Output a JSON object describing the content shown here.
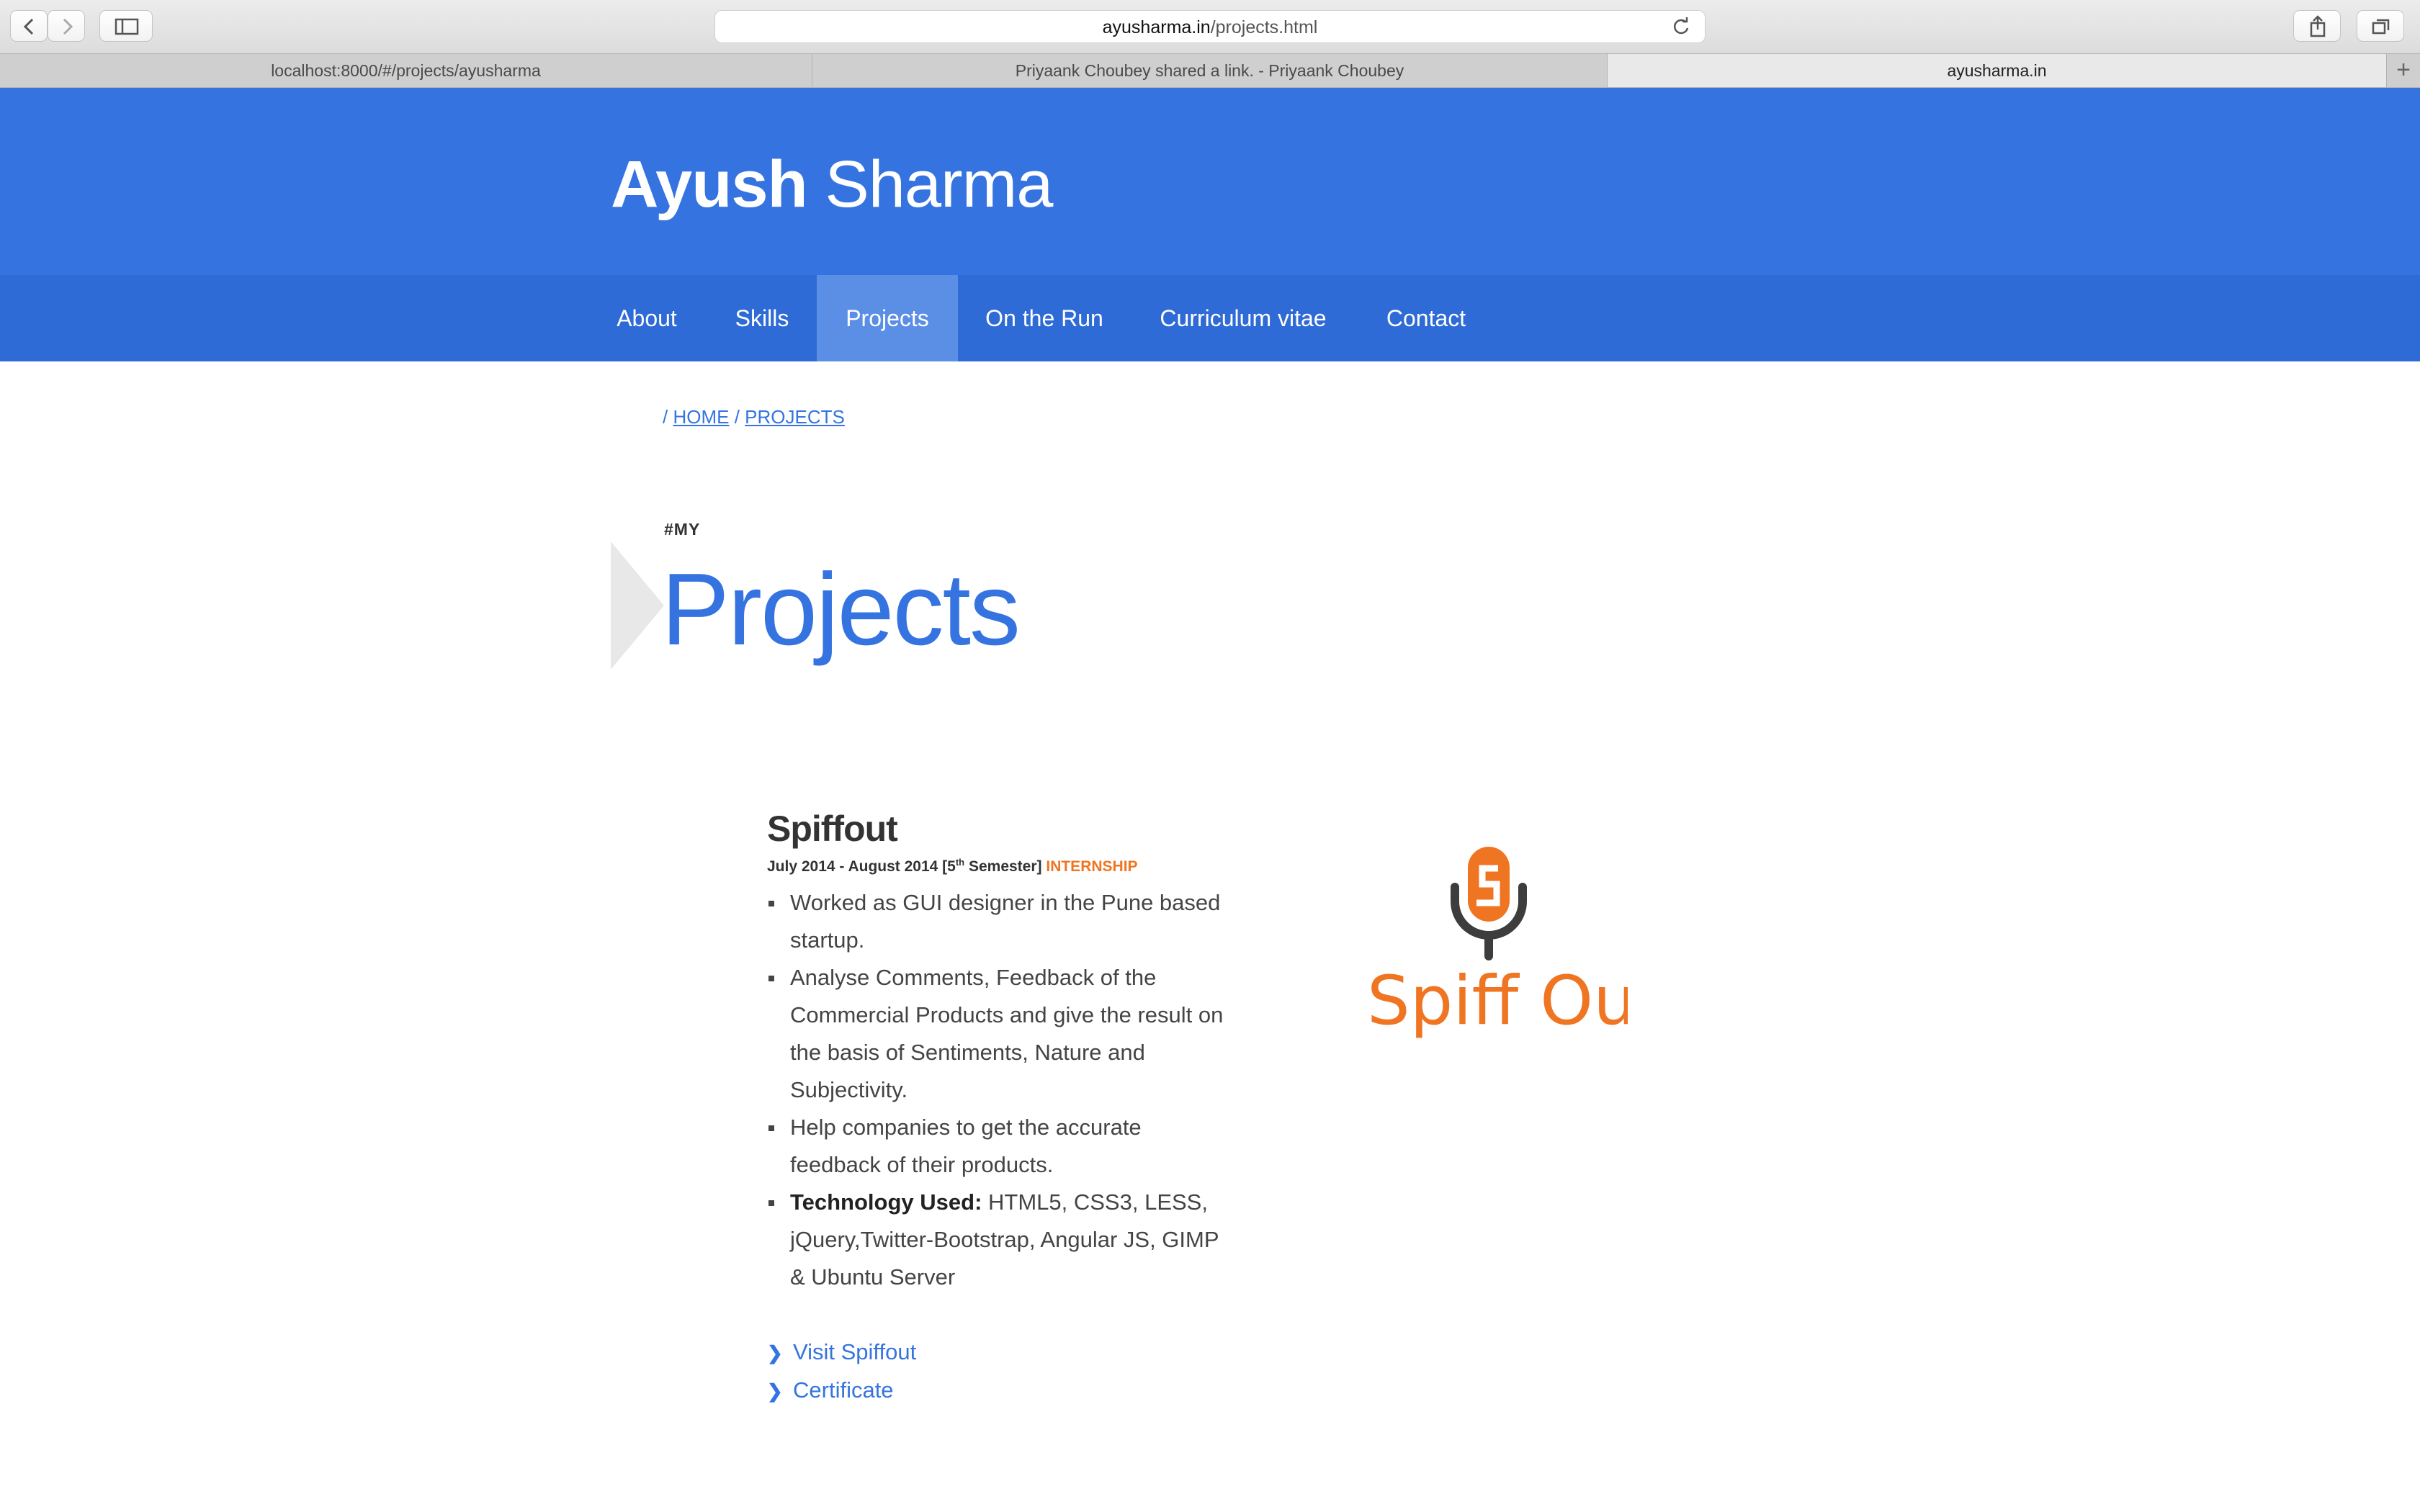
{
  "browser": {
    "address": {
      "domain": "ayusharma.in",
      "path": "/projects.html"
    },
    "tabs": [
      {
        "label": "localhost:8000/#/projects/ayusharma",
        "active": false
      },
      {
        "label": "Priyaank Choubey shared a link. - Priyaank Choubey",
        "active": false
      },
      {
        "label": "ayusharma.in",
        "active": true
      }
    ],
    "icons": [
      "back-icon",
      "forward-icon",
      "sidebar-icon",
      "reload-icon",
      "share-icon",
      "tabs-overview-icon",
      "new-tab-icon"
    ]
  },
  "site": {
    "title_first": "Ayush",
    "title_last": "Sharma",
    "brand_color": "#3574e0",
    "accent_color": "#f07522"
  },
  "nav": {
    "items": [
      {
        "label": "About"
      },
      {
        "label": "Skills"
      },
      {
        "label": "Projects",
        "active": true
      },
      {
        "label": "On the Run"
      },
      {
        "label": "Curriculum vitae"
      },
      {
        "label": "Contact"
      }
    ]
  },
  "breadcrumb": {
    "sep": "/",
    "home": "HOME",
    "projects": "PROJECTS"
  },
  "heading": {
    "tagline": "#MY",
    "title": "Projects"
  },
  "project": {
    "title": "Spiffout",
    "meta_prefix": "July 2014 - August 2014 [5",
    "meta_sup": "th",
    "meta_suffix": " Semester]",
    "badge": "INTERNSHIP",
    "bullets": [
      "Worked as GUI designer in the Pune based startup.",
      "Analyse Comments, Feedback of the Commercial Products and give the result on the basis of Sentiments, Nature and Subjectivity.",
      "Help companies to get the accurate feedback of their products."
    ],
    "tech_label": "Technology Used:",
    "tech_value": " HTML5, CSS3, LESS, jQuery,Twitter-Bootstrap, Angular JS, GIMP & Ubuntu Server",
    "links": [
      {
        "label": "Visit Spiffout"
      },
      {
        "label": "Certificate"
      }
    ],
    "logo_text": "Spiff Out",
    "logo_icon": "microphone-icon"
  }
}
